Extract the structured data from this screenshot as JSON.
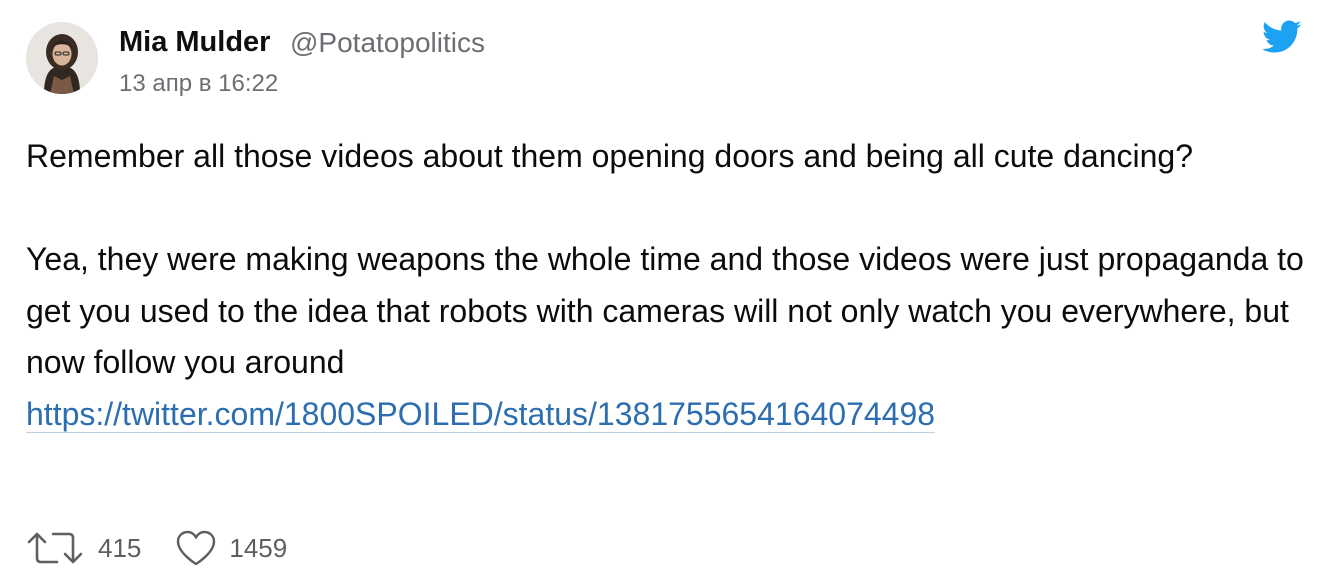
{
  "tweet": {
    "author": {
      "name": "Mia Mulder",
      "handle": "@Potatopolitics"
    },
    "timestamp": "13 апр в 16:22",
    "paragraph_1": "Remember all those videos about them opening doors and being all cute dancing?",
    "paragraph_2": "Yea, they were making weapons the whole time and those videos were just propaganda to get you used to the idea that robots with cameras will not only watch you everywhere, but now follow you around",
    "link": "https://twitter.com/1800SPOILED/status/1381755654164074498",
    "retweets": "415",
    "likes": "1459"
  },
  "icons": {
    "brand": "twitter-bird-icon",
    "retweet": "retweet-icon",
    "like": "heart-icon"
  },
  "colors": {
    "brand_blue": "#1da1f2",
    "link": "#2d6eb1",
    "muted_text": "#6b6f73"
  }
}
